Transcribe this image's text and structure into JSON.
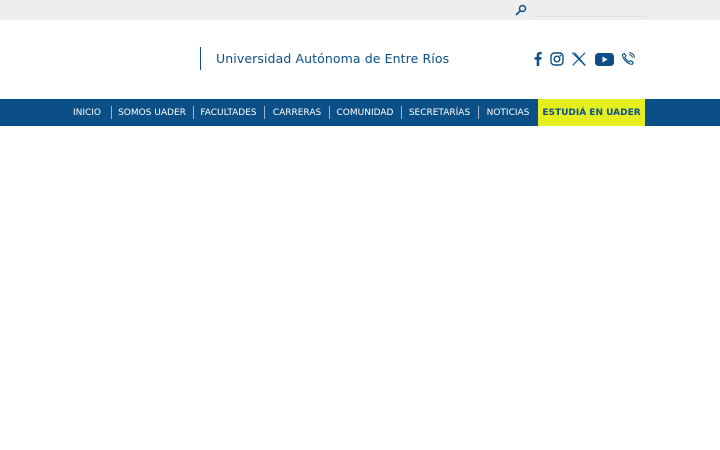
{
  "colors": {
    "brand_blue": "#0b4f86",
    "cta_yellow": "#e5ef1f",
    "topbar_gray": "#eeeeee"
  },
  "topbar": {
    "search_icon": "search-icon",
    "search_value": "",
    "search_placeholder": ""
  },
  "header": {
    "university_name": "Universidad Autónoma de Entre Ríos",
    "social_icons": [
      "facebook-icon",
      "instagram-icon",
      "x-twitter-icon",
      "youtube-icon",
      "phone-icon"
    ]
  },
  "nav": {
    "items": [
      {
        "label": "INICIO"
      },
      {
        "label": "SOMOS UADER"
      },
      {
        "label": "FACULTADES"
      },
      {
        "label": "CARRERAS"
      },
      {
        "label": "COMUNIDAD"
      },
      {
        "label": "SECRETARÍAS"
      },
      {
        "label": "NOTICIAS"
      }
    ],
    "cta_label": "ESTUDIÁ EN UADER"
  }
}
